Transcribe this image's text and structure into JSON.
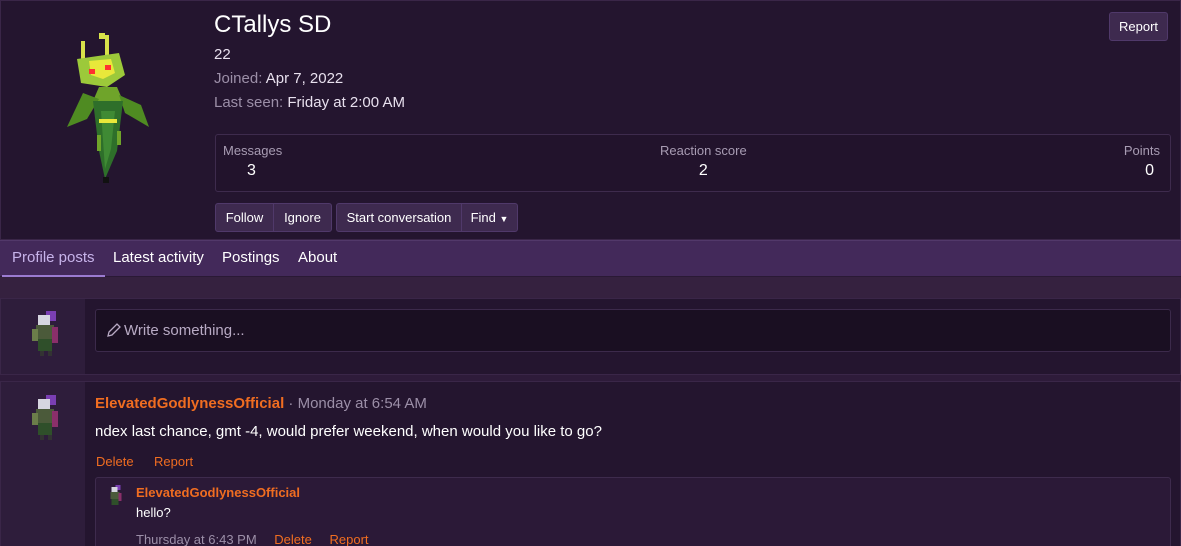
{
  "profile": {
    "name": "CTallys SD",
    "age": "22",
    "joined_label": "Joined:",
    "joined_value": "Apr 7, 2022",
    "last_seen_label": "Last seen:",
    "last_seen_value": "Friday at 2:00 AM",
    "report_label": "Report",
    "stats": [
      {
        "label": "Messages",
        "value": "3"
      },
      {
        "label": "Reaction score",
        "value": "2"
      },
      {
        "label": "Points",
        "value": "0"
      }
    ],
    "buttons": {
      "follow": "Follow",
      "ignore": "Ignore",
      "start_conversation": "Start conversation",
      "find": "Find"
    }
  },
  "tabs": [
    {
      "label": "Profile posts",
      "active": true
    },
    {
      "label": "Latest activity",
      "active": false
    },
    {
      "label": "Postings",
      "active": false
    },
    {
      "label": "About",
      "active": false
    }
  ],
  "composer": {
    "placeholder": "Write something..."
  },
  "post": {
    "author": "ElevatedGodlynessOfficial",
    "separator": " · ",
    "time": "Monday at 6:54 AM",
    "body": "ndex last chance, gmt -4, would prefer weekend, when would you like to go?",
    "delete_label": "Delete",
    "report_label": "Report",
    "comment": {
      "author": "ElevatedGodlynessOfficial",
      "body": "hello?",
      "time": "Thursday at 6:43 PM",
      "delete_label": "Delete",
      "report_label": "Report"
    }
  },
  "colors": {
    "accent": "#f06d21",
    "tab_active": "#c7b3ea",
    "background": "#2e1b3a"
  }
}
